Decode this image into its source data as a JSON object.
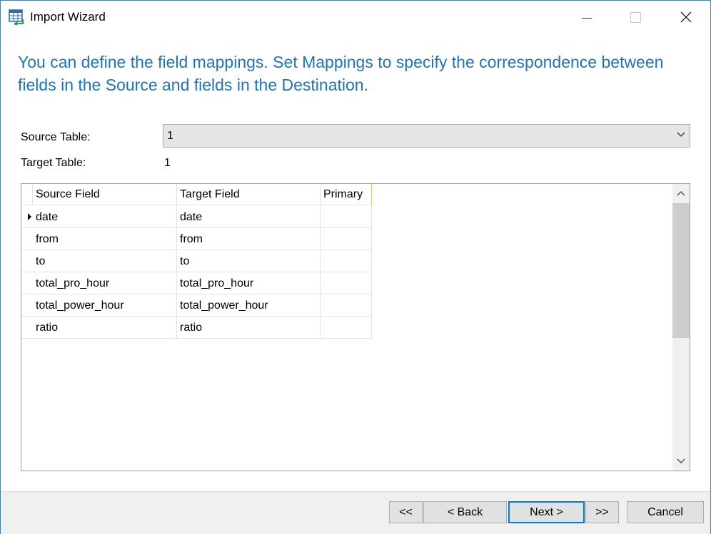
{
  "window": {
    "title": "Import Wizard",
    "icon": "table-import-icon"
  },
  "instruction": "You can define the field mappings. Set Mappings to specify the correspondence between fields in the Source and fields in the Destination.",
  "form": {
    "source_label": "Source Table:",
    "source_value": "1",
    "target_label": "Target Table:",
    "target_value": "1"
  },
  "grid": {
    "columns": [
      "Source Field",
      "Target Field",
      "Primary"
    ],
    "rows": [
      {
        "source": "date",
        "target": "date",
        "primary": ""
      },
      {
        "source": "from",
        "target": "from",
        "primary": ""
      },
      {
        "source": "to",
        "target": "to",
        "primary": ""
      },
      {
        "source": "total_pro_hour",
        "target": "total_pro_hour",
        "primary": ""
      },
      {
        "source": "total_power_hour",
        "target": "total_power_hour",
        "primary": ""
      },
      {
        "source": "ratio",
        "target": "ratio",
        "primary": ""
      }
    ]
  },
  "buttons": {
    "first": "<<",
    "back": "< Back",
    "next": "Next >",
    "last": ">>",
    "cancel": "Cancel"
  },
  "colors": {
    "instruction_text": "#1e73be",
    "default_button_border": "#0078d7"
  }
}
